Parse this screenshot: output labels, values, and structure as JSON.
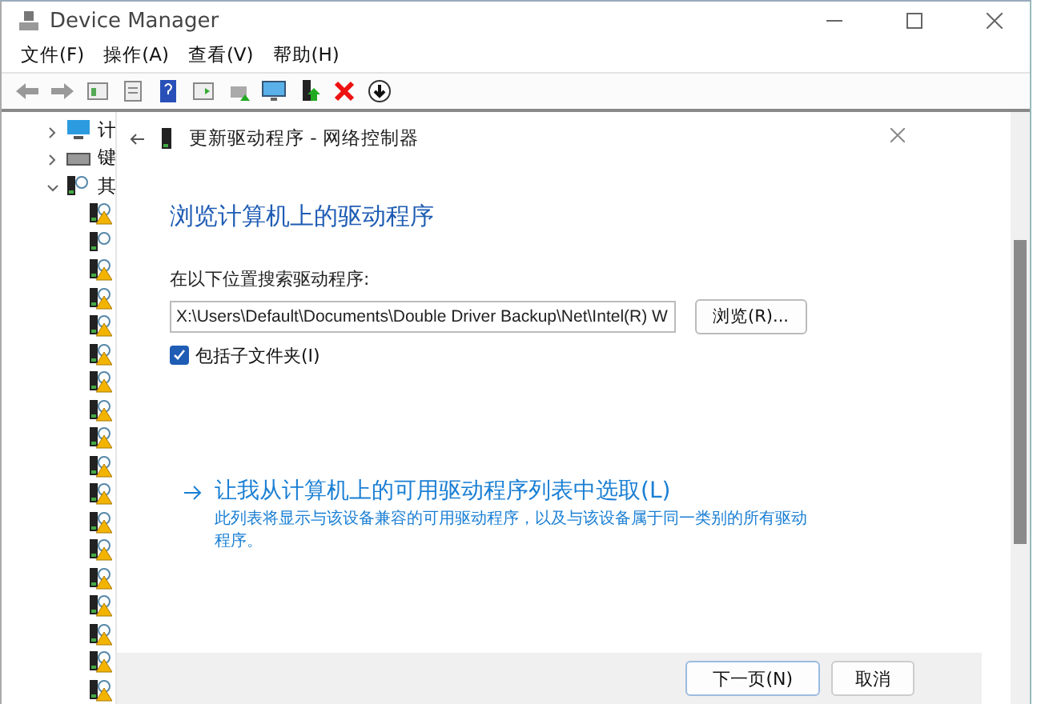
{
  "window": {
    "title": "Device Manager"
  },
  "menu": [
    "文件(F)",
    "操作(A)",
    "查看(V)",
    "帮助(H)"
  ],
  "tree": [
    {
      "label": "计",
      "kind": "computer",
      "expanded": false
    },
    {
      "label": "键",
      "kind": "keyboard",
      "expanded": false
    },
    {
      "label": "其",
      "kind": "other",
      "expanded": true,
      "children": [
        {
          "kind": "warning"
        },
        {
          "kind": "unknown"
        },
        {
          "kind": "warning"
        },
        {
          "kind": "warning"
        },
        {
          "kind": "warning"
        },
        {
          "kind": "warning"
        },
        {
          "kind": "warning"
        },
        {
          "kind": "warning"
        },
        {
          "kind": "warning"
        },
        {
          "kind": "warning"
        },
        {
          "kind": "warning"
        },
        {
          "kind": "warning"
        },
        {
          "kind": "warning"
        },
        {
          "kind": "warning"
        },
        {
          "kind": "warning"
        },
        {
          "kind": "warning"
        },
        {
          "kind": "warning"
        },
        {
          "kind": "warning"
        }
      ]
    }
  ],
  "dialog": {
    "title": "更新驱动程序 - 网络控制器",
    "heading": "浏览计算机上的驱动程序",
    "search_label": "在以下位置搜索驱动程序:",
    "path": "X:\\Users\\Default\\Documents\\Double Driver Backup\\Net\\Intel(R) W",
    "browse_button": "浏览(R)...",
    "include_subfolders": {
      "label": "包括子文件夹(I)",
      "checked": true
    },
    "pick_link": "让我从计算机上的可用驱动程序列表中选取(L)",
    "pick_description": "此列表将显示与该设备兼容的可用驱动程序，以及与该设备属于同一类别的所有驱动程序。",
    "buttons": [
      "下一页(N)",
      "取消"
    ]
  }
}
